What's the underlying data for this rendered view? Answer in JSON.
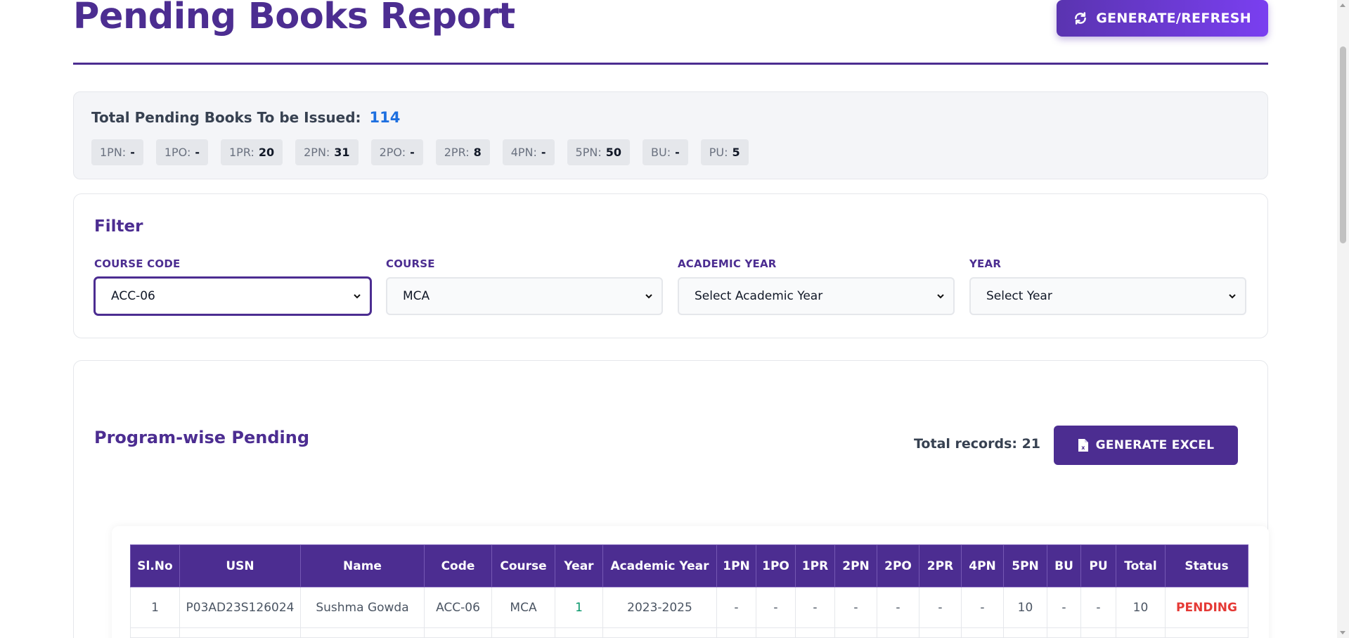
{
  "header": {
    "title": "Pending Books Report",
    "refresh_label": "GENERATE/REFRESH"
  },
  "summary": {
    "label": "Total Pending Books To be Issued:",
    "total": "114",
    "chips": [
      {
        "key": "1PN:",
        "value": "-"
      },
      {
        "key": "1PO:",
        "value": "-"
      },
      {
        "key": "1PR:",
        "value": "20"
      },
      {
        "key": "2PN:",
        "value": "31"
      },
      {
        "key": "2PO:",
        "value": "-"
      },
      {
        "key": "2PR:",
        "value": "8"
      },
      {
        "key": "4PN:",
        "value": "-"
      },
      {
        "key": "5PN:",
        "value": "50"
      },
      {
        "key": "BU:",
        "value": "-"
      },
      {
        "key": "PU:",
        "value": "5"
      }
    ]
  },
  "filter": {
    "title": "Filter",
    "fields": [
      {
        "label": "COURSE CODE",
        "value": "ACC-06"
      },
      {
        "label": "COURSE",
        "value": "MCA"
      },
      {
        "label": "ACADEMIC YEAR",
        "value": "Select Academic Year"
      },
      {
        "label": "YEAR",
        "value": "Select Year"
      }
    ]
  },
  "program": {
    "title": "Program-wise Pending",
    "records_label": "Total records: 21",
    "excel_label": "GENERATE EXCEL",
    "columns": [
      "Sl.No",
      "USN",
      "Name",
      "Code",
      "Course",
      "Year",
      "Academic Year",
      "1PN",
      "1PO",
      "1PR",
      "2PN",
      "2PO",
      "2PR",
      "4PN",
      "5PN",
      "BU",
      "PU",
      "Total",
      "Status"
    ],
    "rows": [
      [
        "1",
        "P03AD23S126024",
        "Sushma Gowda",
        "ACC-06",
        "MCA",
        "1",
        "2023-2025",
        "-",
        "-",
        "-",
        "-",
        "-",
        "-",
        "-",
        "10",
        "-",
        "-",
        "10",
        "PENDING"
      ]
    ]
  },
  "colors": {
    "primary": "#4c2d91",
    "accent_blue": "#1d6fe0",
    "status_pending": "#e53935"
  }
}
